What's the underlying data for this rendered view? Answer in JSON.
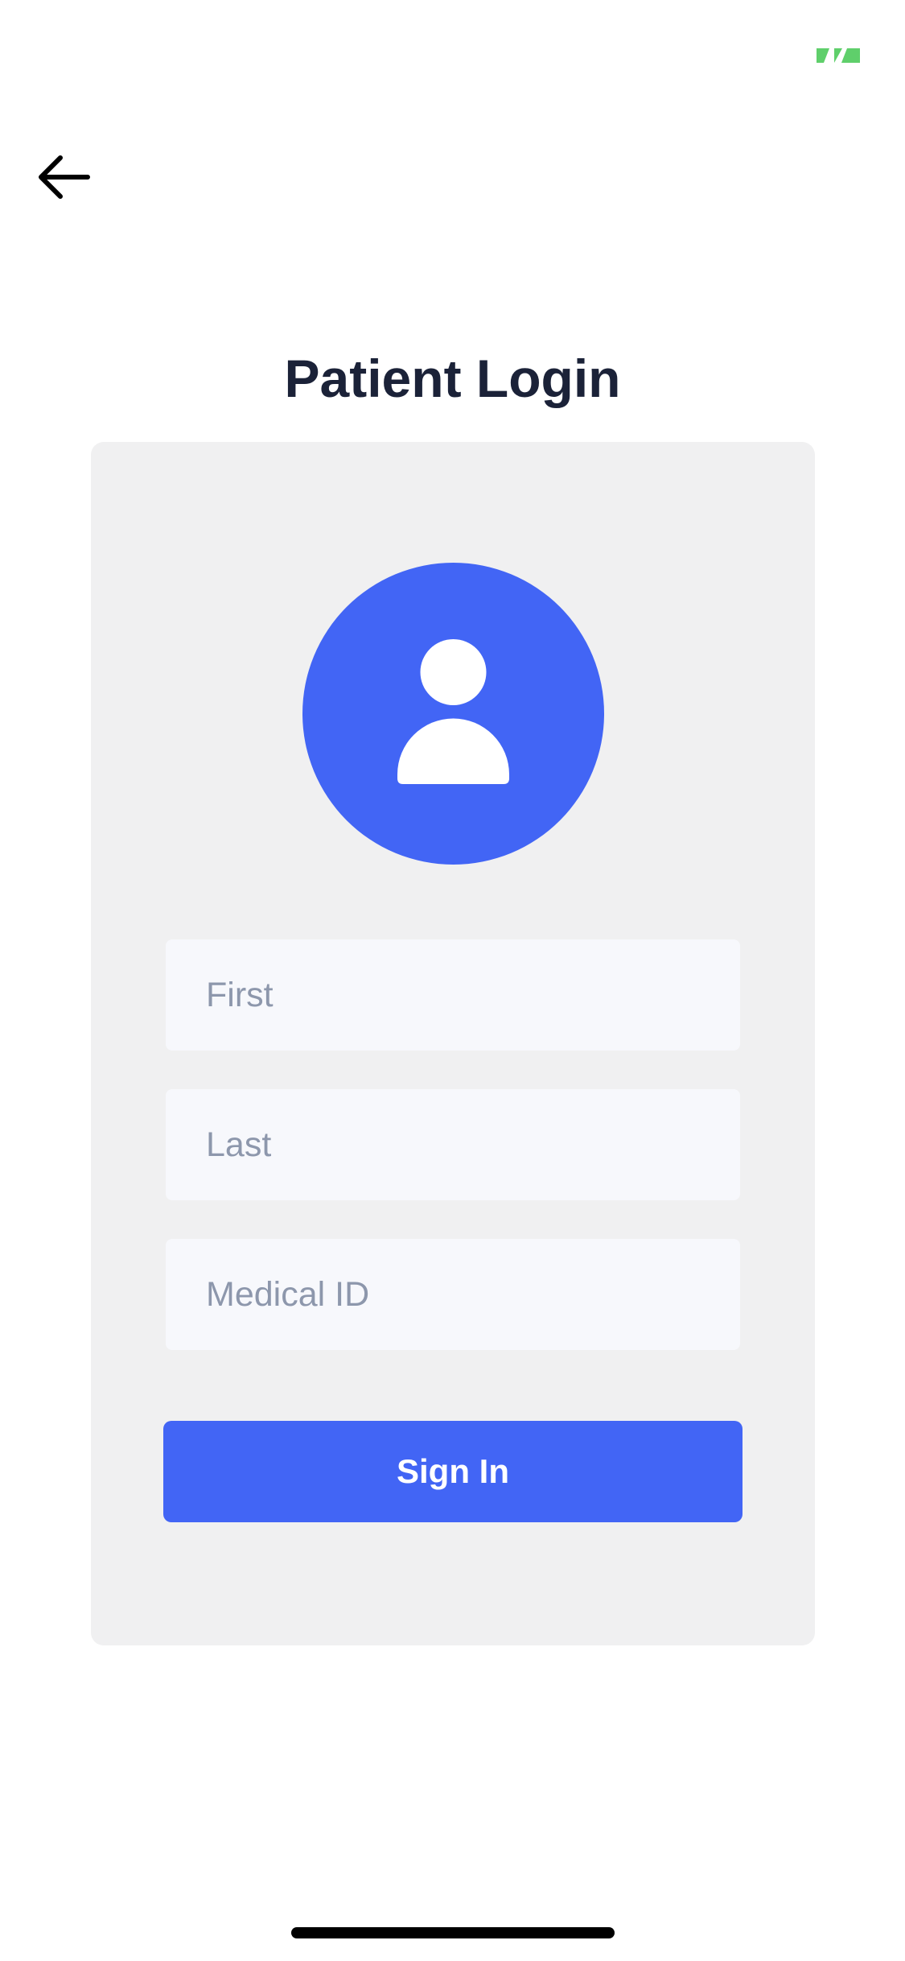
{
  "status_bar": {
    "battery_icon": "battery-charging-icon",
    "battery_color": "#5fcf6b"
  },
  "header": {
    "back_icon": "arrow-left-icon",
    "title": "Patient Login"
  },
  "card": {
    "avatar_icon": "user-icon",
    "accent_color": "#4265f5",
    "fields": {
      "first_placeholder": "First",
      "last_placeholder": "Last",
      "medical_id_placeholder": "Medical ID"
    },
    "sign_in_label": "Sign In"
  }
}
